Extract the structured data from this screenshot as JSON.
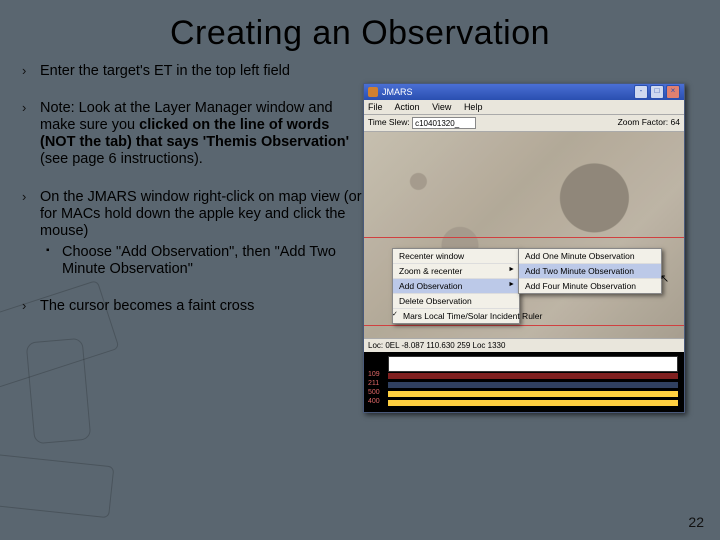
{
  "title": "Creating an Observation",
  "bullets": {
    "b1": "Enter the target's ET in the top left field",
    "b2a": "Note:  Look at the Layer Manager window and make sure you ",
    "b2b": "clicked on the line of words (NOT the tab)  that says 'Themis Observation'",
    "b2c": " (see page 6 instructions).",
    "b3": "On the JMARS window right-click on map view (or for MACs hold down the apple key and click the mouse)",
    "b3s": "Choose \"Add Observation\", then \"Add Two Minute Observation\"",
    "b4": "The cursor becomes a faint cross"
  },
  "page_num": "22",
  "app": {
    "title": "JMARS",
    "menu": {
      "m1": "File",
      "m2": "Action",
      "m3": "View",
      "m4": "Help"
    },
    "timeslew_label": "Time Slew:",
    "timeslew_value": "c10401320_",
    "zoom_label": "Zoom Factor:",
    "zoom_value": "64",
    "context": {
      "c1": "Recenter window",
      "c2": "Zoom & recenter",
      "c3": "Add Observation",
      "c4": "Delete Observation",
      "c5": "Mars Local Time/Solar Incident Ruler"
    },
    "sub": {
      "s1": "Add One Minute Observation",
      "s2": "Add Two Minute Observation",
      "s3": "Add Four Minute Observation"
    },
    "status": "Loc: 0EL  -8.087        110.630 259        Loc  1330",
    "layers": {
      "l1": "109",
      "l2": "211",
      "l3": "500",
      "l4": "400"
    }
  }
}
